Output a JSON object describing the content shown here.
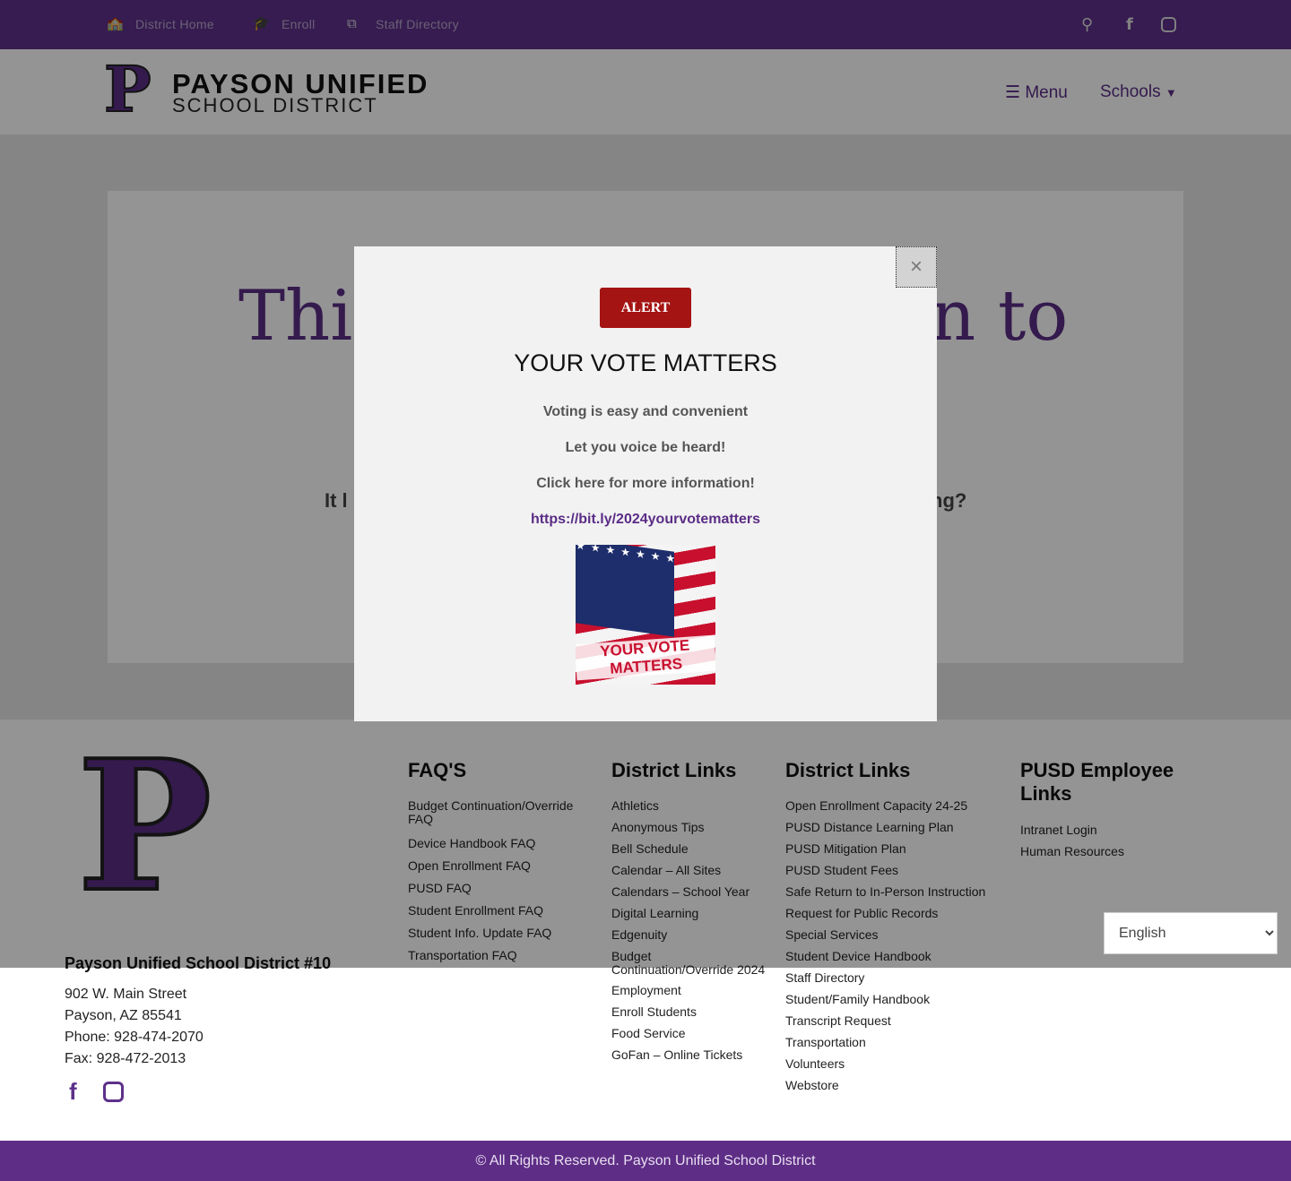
{
  "topbar": {
    "links": [
      {
        "label": "District Home",
        "icon": "school-icon"
      },
      {
        "label": "Enroll",
        "icon": "graduation-cap-icon"
      },
      {
        "label": "Staff Directory",
        "icon": "teacher-icon"
      }
    ]
  },
  "header": {
    "logo_letter": "P",
    "brand_line1": "PAYSON UNIFIED",
    "brand_line2": "SCHOOL DISTRICT",
    "menu_label": "Menu",
    "schools_label": "Schools"
  },
  "main": {
    "heading_left": "This",
    "heading_right": "n to",
    "sub_left": "It l",
    "sub_right": "ng?"
  },
  "modal": {
    "close_symbol": "×",
    "alert_label": "ALERT",
    "title": "YOUR VOTE MATTERS",
    "lines": [
      "Voting is easy and convenient",
      "Let you voice be heard!",
      "Click here for more information!"
    ],
    "link": "https://bit.ly/2024yourvotematters",
    "image_text": "YOUR VOTE MATTERS"
  },
  "footer": {
    "logo_letter": "P",
    "org_name": "Payson Unified School District #10",
    "address": [
      "902 W. Main Street",
      "Payson, AZ 85541",
      "Phone: 928-474-2070",
      "Fax: 928-472-2013"
    ],
    "faq": {
      "title": "FAQ'S",
      "items": [
        "Budget Continuation/Override FAQ",
        "Device Handbook FAQ",
        "Open Enrollment FAQ",
        "PUSD FAQ",
        "Student Enrollment FAQ",
        "Student Info. Update FAQ",
        "Transportation FAQ"
      ]
    },
    "links1": {
      "title": "District Links",
      "items": [
        "Athletics",
        "Anonymous Tips",
        "Bell Schedule",
        "Calendar – All Sites",
        "Calendars – School Year",
        "Digital Learning",
        "Edgenuity",
        "Budget Continuation/Override 2024",
        "Employment",
        "Enroll Students",
        "Food Service",
        "GoFan – Online Tickets"
      ]
    },
    "links2": {
      "title": "District Links",
      "items": [
        "Open Enrollment Capacity 24-25",
        "PUSD Distance Learning Plan",
        "PUSD Mitigation Plan",
        "PUSD Student Fees",
        "Safe Return to In-Person Instruction",
        "Request for Public Records",
        "Special Services",
        "Student Device Handbook",
        "Staff Directory",
        "Student/Family Handbook",
        "Transcript Request",
        "Transportation",
        "Volunteers",
        "Webstore"
      ]
    },
    "employee": {
      "title": "PUSD Employee Links",
      "items": [
        "Intranet Login",
        "Human Resources"
      ]
    },
    "language": "English",
    "copyright": "© All Rights Reserved. Payson Unified School District"
  },
  "colors": {
    "brand_purple": "#5d318a",
    "alert_red": "#a41413"
  }
}
